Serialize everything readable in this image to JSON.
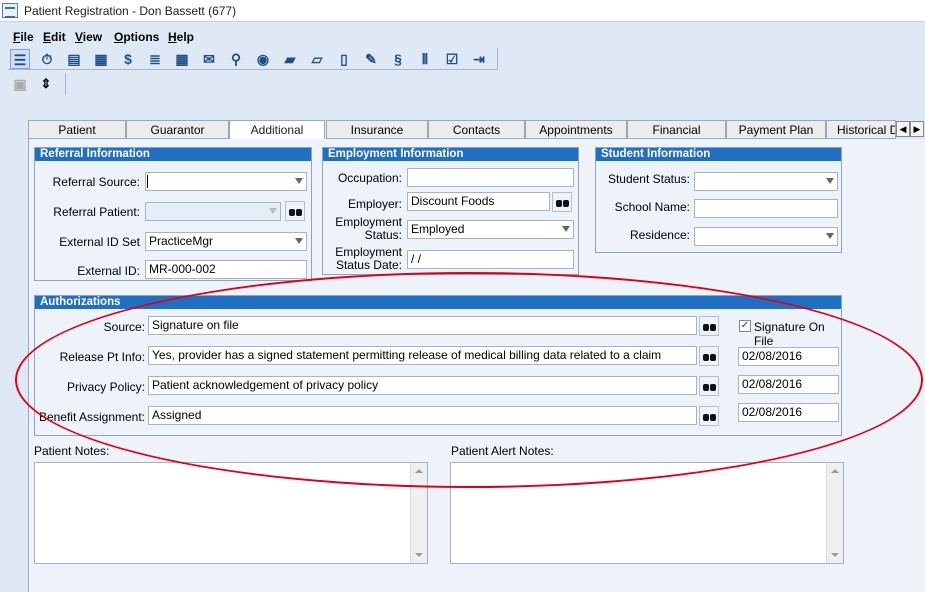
{
  "window": {
    "title": "Patient Registration - Don Bassett (677)"
  },
  "menu": [
    {
      "label": "File",
      "underline": "F"
    },
    {
      "label": "Edit",
      "underline": "E"
    },
    {
      "label": "View",
      "underline": "V"
    },
    {
      "label": "Options",
      "underline": "O"
    },
    {
      "label": "Help",
      "underline": "H"
    }
  ],
  "toolbar_icons": [
    "list-icon",
    "stopwatch-icon",
    "card-icon",
    "calculator-money-icon",
    "dollar-icon",
    "invoice-icon",
    "calculator-icon",
    "envelope-money-icon",
    "search-money-icon",
    "coin-icon",
    "folder-icon",
    "folder-open-icon",
    "document-icon",
    "wrench-icon",
    "money-doc-icon",
    "chart-money-icon",
    "checklist-icon",
    "exit-icon"
  ],
  "tabs": [
    "Patient",
    "Guarantor",
    "Additional",
    "Insurance",
    "Contacts",
    "Appointments",
    "Financial",
    "Payment Plan",
    "Historical D"
  ],
  "active_tab": "Additional",
  "referral": {
    "header": "Referral Information",
    "source_label": "Referral Source:",
    "source_value": "",
    "patient_label": "Referral Patient:",
    "patient_value": "",
    "external_id_set_label": "External ID Set",
    "external_id_set_value": "PracticeMgr",
    "external_id_label": "External ID:",
    "external_id_value": "MR-000-002"
  },
  "employment": {
    "header": "Employment Information",
    "occupation_label": "Occupation:",
    "occupation_value": "",
    "employer_label": "Employer:",
    "employer_value": "Discount Foods",
    "status_label_1": "Employment",
    "status_label_2": "Status:",
    "status_value": "Employed",
    "status_date_label_1": "Employment",
    "status_date_label_2": "Status Date:",
    "status_date_value": " /  /"
  },
  "student": {
    "header": "Student Information",
    "status_label": "Student Status:",
    "status_value": "",
    "school_label": "School Name:",
    "school_value": "",
    "residence_label": "Residence:",
    "residence_value": ""
  },
  "authorizations": {
    "header": "Authorizations",
    "source_label": "Source:",
    "source_value": "Signature on file",
    "signature_label": "Signature On File",
    "signature_checked": true,
    "release_label": "Release Pt Info:",
    "release_value": "Yes, provider has a signed statement permitting release of medical billing data related to a claim",
    "release_date": "02/08/2016",
    "privacy_label": "Privacy Policy:",
    "privacy_value": "Patient acknowledgement of privacy policy",
    "privacy_date": "02/08/2016",
    "benefit_label": "Benefit Assignment:",
    "benefit_value": "Assigned",
    "benefit_date": "02/08/2016"
  },
  "notes": {
    "patient_label": "Patient Notes:",
    "alert_label": "Patient Alert Notes:"
  }
}
